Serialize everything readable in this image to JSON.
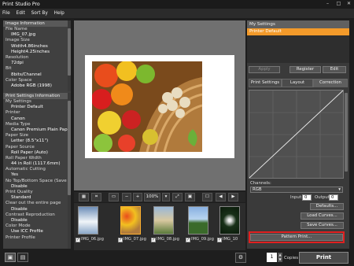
{
  "window": {
    "title": "Print Studio Pro",
    "minimize": "–",
    "maximize": "□",
    "close": "✕"
  },
  "menu": [
    "File",
    "Edit",
    "Sort By",
    "Help"
  ],
  "image_info": {
    "header": "Image Information",
    "rows": [
      {
        "label": "File Name",
        "value": "IMG_07.jpg"
      },
      {
        "label": "Image Size",
        "value": "Width4.86inches"
      },
      {
        "label": "",
        "value": "Height4.25inches"
      },
      {
        "label": "Resolution",
        "value": "72dpi"
      },
      {
        "label": "Bit",
        "value": "8bits/Channel"
      },
      {
        "label": "Color Space",
        "value": "Adobe RGB (1998)"
      }
    ]
  },
  "print_settings": {
    "header": "Print Settings Information",
    "rows": [
      {
        "label": "My Settings",
        "value": "Printer Default"
      },
      {
        "label": "Printer",
        "value": "Canon"
      },
      {
        "label": "Media Type",
        "value": "Canon Premium Plain Paper 80"
      },
      {
        "label": "Paper Size",
        "value": "Letter (8.5\"x11\")"
      },
      {
        "label": "Paper Source",
        "value": "Roll Paper (Auto)"
      },
      {
        "label": "Roll Paper Width",
        "value": "44 in Roll (1117.6mm)"
      },
      {
        "label": "Automatic Cutting",
        "value": "Yes"
      },
      {
        "label": "No Top/Bottom Space (Save Paper)",
        "value": "Disable"
      },
      {
        "label": "Print Quality",
        "value": "Standard"
      },
      {
        "label": "Clear out the entire page",
        "value": "Disable"
      },
      {
        "label": "Contrast Reproduction",
        "value": "Disable"
      },
      {
        "label": "Color Mode",
        "value": "Use ICC Profile"
      },
      {
        "label": "Printer Profile",
        "value": ""
      }
    ]
  },
  "toolbar": {
    "zoom": "100%"
  },
  "thumbnails": [
    {
      "name": "IMG_06.jpg",
      "checked": true,
      "selected": false
    },
    {
      "name": "IMG_07.jpg",
      "checked": true,
      "selected": true
    },
    {
      "name": "IMG_08.jpg",
      "checked": true,
      "selected": false
    },
    {
      "name": "IMG_09.jpg",
      "checked": true,
      "selected": false
    },
    {
      "name": "IMG_10",
      "checked": true,
      "selected": false
    }
  ],
  "my_settings": {
    "header": "My Settings",
    "selected": "Printer Default",
    "apply": "Apply",
    "register": "Register",
    "edit": "Edit"
  },
  "tabs": [
    "Print Settings",
    "Layout",
    "Correction"
  ],
  "correction": {
    "channels_label": "Channels:",
    "channel": "RGB",
    "input_label": "Input:",
    "input_value": "0",
    "output_label": "Output:",
    "output_value": "0",
    "defaults": "Defaults...",
    "load_curves": "Load Curves...",
    "save_curves": "Save Curves...",
    "pattern_print": "Pattern Print...",
    "highlight_color": "#e02020"
  },
  "bottom": {
    "copies_label": "Copies",
    "copies_value": "1",
    "print": "Print"
  },
  "colors": {
    "accent": "#f39a2a"
  }
}
